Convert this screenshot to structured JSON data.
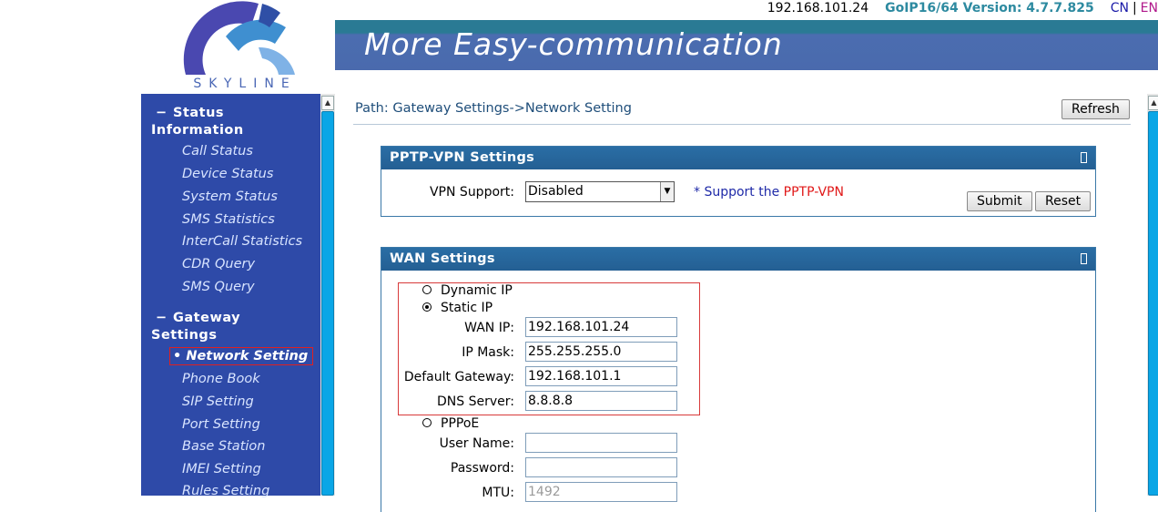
{
  "header": {
    "logo_text": "SKYLINE",
    "ip_address": "192.168.101.24",
    "version": "GoIP16/64 Version: 4.7.7.825",
    "lang_cn": "CN",
    "lang_sep": "|",
    "lang_en": "EN",
    "banner_title": "More Easy-communication"
  },
  "sidebar": {
    "sections": [
      {
        "title_line1": "Status",
        "title_line2": "Information",
        "items": [
          "Call Status",
          "Device Status",
          "System Status",
          "SMS Statistics",
          "InterCall Statistics",
          "CDR Query",
          "SMS Query"
        ]
      },
      {
        "title_line1": "Gateway",
        "title_line2": "Settings",
        "items": [
          "Network Setting",
          "Phone Book",
          "SIP Setting",
          "Port Setting",
          "Base Station",
          "IMEI Setting",
          "Rules Setting"
        ]
      }
    ],
    "active_item": "Network Setting"
  },
  "main": {
    "path": "Path: Gateway Settings->Network Setting",
    "refresh_label": "Refresh",
    "pptp": {
      "title": "PPTP-VPN Settings",
      "vpn_support_label": "VPN Support:",
      "vpn_support_value": "Disabled",
      "support_prefix": "* Support the ",
      "support_link": "PPTP-VPN",
      "submit_label": "Submit",
      "reset_label": "Reset"
    },
    "wan": {
      "title": "WAN Settings",
      "dynamic_ip_label": "Dynamic IP",
      "static_ip_label": "Static IP",
      "wan_ip_label": "WAN IP:",
      "wan_ip_value": "192.168.101.24",
      "ip_mask_label": "IP Mask:",
      "ip_mask_value": "255.255.255.0",
      "gateway_label": "Default Gateway:",
      "gateway_value": "192.168.101.1",
      "dns_label": "DNS Server:",
      "dns_value": "8.8.8.8",
      "pppoe_label": "PPPoE",
      "username_label": "User Name:",
      "username_value": "",
      "password_label": "Password:",
      "password_value": "",
      "mtu_label": "MTU:",
      "mtu_value": "1492",
      "selected_mode": "Static IP"
    }
  },
  "colors": {
    "sidebar_bg": "#2e4aa8",
    "panel_header": "#2a6ea5",
    "banner": "#4a6aad",
    "highlight_border": "#d83a3a"
  }
}
